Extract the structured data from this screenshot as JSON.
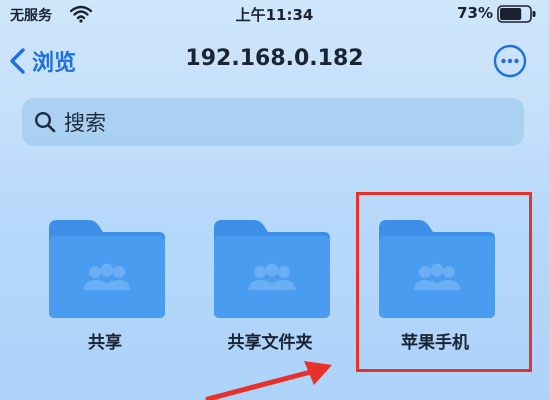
{
  "status_bar": {
    "carrier": "无服务",
    "time": "上午11:34",
    "battery_percent": "73%",
    "battery_level": 0.73
  },
  "nav": {
    "back_label": "浏览",
    "title": "192.168.0.182",
    "more_icon": "ellipsis-circle-icon"
  },
  "search": {
    "placeholder": "搜索",
    "icon": "search-icon"
  },
  "folders": [
    {
      "label": "共享",
      "icon": "shared-folder-icon"
    },
    {
      "label": "共享文件夹",
      "icon": "shared-folder-icon"
    },
    {
      "label": "苹果手机",
      "icon": "shared-folder-icon",
      "highlighted": true
    }
  ],
  "colors": {
    "accent": "#1f6fe0",
    "folder": "#3a8de8",
    "highlight": "#e8312a"
  }
}
